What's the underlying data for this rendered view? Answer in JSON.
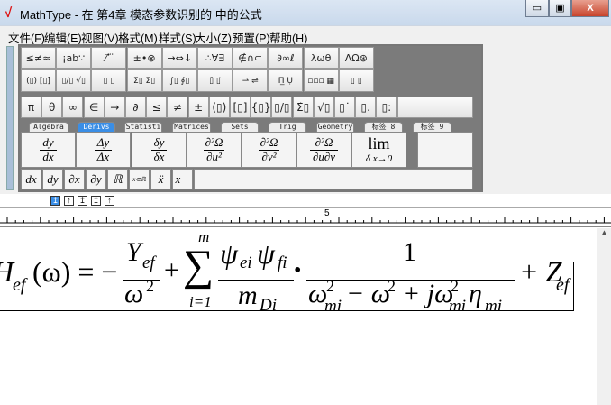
{
  "window": {
    "title": "MathType - 在 第4章  模态参数识别的 中的公式",
    "minimize": "▭",
    "maximize": "▣",
    "close": "X"
  },
  "menu": [
    "文件(F)",
    "编辑(E)",
    "视图(V)",
    "格式(M)",
    "样式(S)",
    "大小(Z)",
    "预置(P)",
    "帮助(H)"
  ],
  "palette_row1": [
    "≤≠≈",
    "¡ab∵",
    "⁄ ⃗ ⃛",
    "±•⊗",
    "→⇔↓",
    "∴∀∃",
    "∉∩⊂",
    "∂∞ℓ",
    "λωθ",
    "ΛΩ⊛"
  ],
  "palette_row2": [
    "(▯) [▯]",
    "▯/▯ √▯",
    "▯ ▯",
    "Σ▯ Σ▯",
    "∫▯ ∮▯",
    "▯̄ ▯⃗",
    "⇀ ⇌",
    "Π̲ Ụ",
    "▫▫▫ ▦",
    "▯ ▯"
  ],
  "palette_row3": [
    "π",
    "θ",
    "∞",
    "∈",
    "→",
    "∂",
    "≤",
    "≠",
    "±",
    "(▯)",
    "[▯]",
    "{▯}",
    "▯/▯",
    "Σ̇▯",
    "√▯",
    "▯˙",
    "▯.",
    "▯:"
  ],
  "tabs": [
    "Algebra",
    "Derivs",
    "Statisti",
    "Matrices",
    "Sets",
    "Trig",
    "Geometry",
    "标签 8",
    "标签 9"
  ],
  "active_tab": "Derivs",
  "templates": [
    {
      "num": "dy",
      "den": "dx"
    },
    {
      "num": "Δy",
      "den": "Δx"
    },
    {
      "num": "δy",
      "den": "δx"
    },
    {
      "num": "∂²Ω",
      "den": "∂u²"
    },
    {
      "num": "∂²Ω",
      "den": "∂v²"
    },
    {
      "num": "∂²Ω",
      "den": "∂u∂v"
    },
    {
      "num": "lim",
      "den": "δ x→0"
    }
  ],
  "small_templates": [
    "dx",
    "dy",
    "∂x",
    "∂y",
    "ℝ",
    "x⊂ℝ",
    "ẍ",
    "x⃛"
  ],
  "nudge_buttons": [
    "↥",
    "↑",
    "↥",
    "↥",
    "↑"
  ],
  "ruler_label": "5",
  "formula": {
    "lhs": "H",
    "lhs_sub": "ef",
    "arg": "(ω) = −",
    "Y": "Y",
    "Y_sub": "ef",
    "omega2": "ω",
    "sq": "2",
    "plus": "+",
    "sum_top": "m",
    "sum": "∑",
    "sum_bot": "i=1",
    "psi_ei": "ψ",
    "ei": "ei",
    "psi_fi": "ψ",
    "fi": "fi",
    "m": "m",
    "Di": "Di",
    "dot": "•",
    "one": "1",
    "den1": "ω",
    "mi": "mi",
    "den2": "− ω",
    "den3": "+ jω",
    "eta": "η",
    "Z": "+ Z",
    "Z_sub": "ef"
  }
}
